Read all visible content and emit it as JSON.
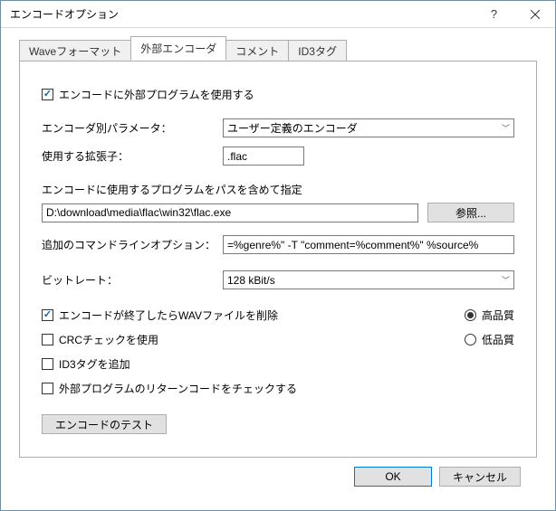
{
  "window": {
    "title": "エンコードオプション"
  },
  "tabs": {
    "items": [
      {
        "label": "Waveフォーマット"
      },
      {
        "label": "外部エンコーダ"
      },
      {
        "label": "コメント"
      },
      {
        "label": "ID3タグ"
      }
    ],
    "active_index": 1
  },
  "panel": {
    "use_external_label": "エンコードに外部プログラムを使用する",
    "encoder_param_label": "エンコーダ別パラメータ：",
    "encoder_select_value": "ユーザー定義のエンコーダ",
    "ext_label": "使用する拡張子：",
    "ext_value": ".flac",
    "program_path_label": "エンコードに使用するプログラムをパスを含めて指定",
    "program_path_value": "D:\\download\\media\\flac\\win32\\flac.exe",
    "browse_button": "参照...",
    "cmdline_label": "追加のコマンドラインオプション：",
    "cmdline_value": "=%genre%\" -T \"comment=%comment%\" %source%",
    "bitrate_label": "ビットレート：",
    "bitrate_value": "128 kBit/s",
    "delete_wav_label": "エンコードが終了したらWAVファイルを削除",
    "crc_label": "CRCチェックを使用",
    "id3_label": "ID3タグを追加",
    "retcode_label": "外部プログラムのリターンコードをチェックする",
    "quality_high": "高品質",
    "quality_low": "低品質",
    "test_button": "エンコードのテスト"
  },
  "footer": {
    "ok": "OK",
    "cancel": "キャンセル"
  }
}
